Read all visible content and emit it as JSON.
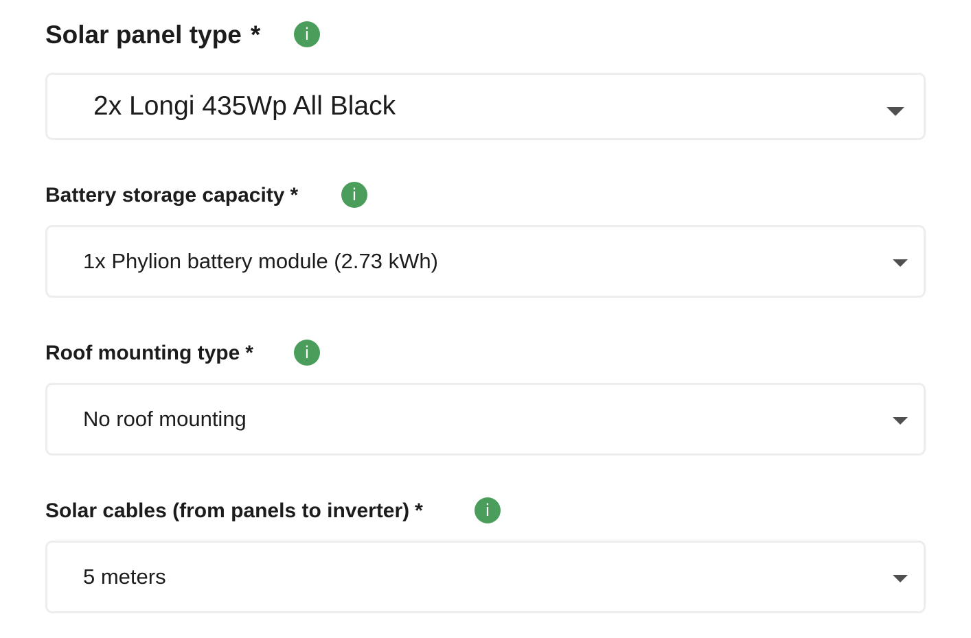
{
  "colors": {
    "accent": "#4a9d5b",
    "border": "#ededed",
    "text": "#1c1c1c",
    "caret": "#505050"
  },
  "fields": [
    {
      "label": "Solar panel type",
      "required_mark": "*",
      "info_icon": "info-icon",
      "info_glyph": "i",
      "selected_value": "2x Longi 435Wp All Black",
      "dropdown_icon": "caret-down-icon"
    },
    {
      "label": "Battery storage capacity",
      "required_mark": "*",
      "info_icon": "info-icon",
      "info_glyph": "i",
      "selected_value": "1x Phylion battery module (2.73 kWh)",
      "dropdown_icon": "caret-down-icon"
    },
    {
      "label": "Roof mounting type",
      "required_mark": "*",
      "info_icon": "info-icon",
      "info_glyph": "i",
      "selected_value": "No roof mounting",
      "dropdown_icon": "caret-down-icon"
    },
    {
      "label": "Solar cables (from panels to inverter)",
      "required_mark": "*",
      "info_icon": "info-icon",
      "info_glyph": "i",
      "selected_value": "5 meters",
      "dropdown_icon": "caret-down-icon"
    }
  ]
}
